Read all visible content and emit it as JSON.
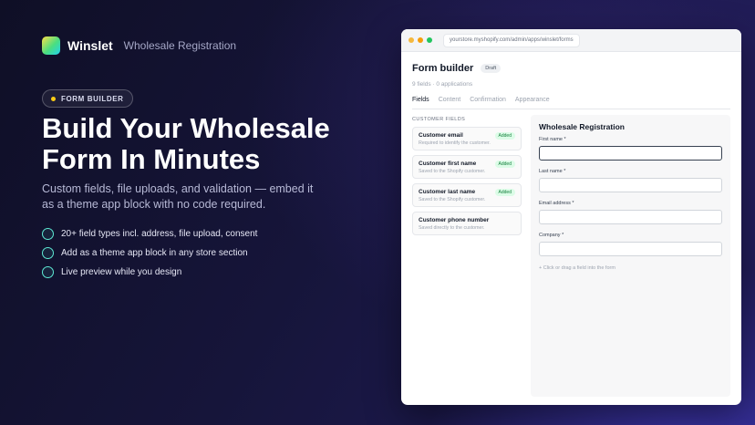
{
  "brand": {
    "name": "Winslet",
    "subtitle": "Wholesale Registration"
  },
  "pill": {
    "label": "FORM BUILDER"
  },
  "hero": {
    "headline": "Build Your Wholesale Form In Minutes",
    "subtext": "Custom fields, file uploads, and validation — embed it as a theme app block with no code required.",
    "features": [
      "20+ field types incl. address, file upload, consent",
      "Add as a theme app block in any store section",
      "Live preview while you design"
    ]
  },
  "browser": {
    "url": "yourstore.myshopify.com/admin/apps/winslet/forms"
  },
  "builder": {
    "title": "Form builder",
    "status": "Draft",
    "meta": "9 fields · 0 applications",
    "tabs": [
      "Fields",
      "Content",
      "Confirmation",
      "Appearance"
    ],
    "active_tab": "Fields",
    "section_label": "CUSTOMER FIELDS",
    "fields": [
      {
        "name": "Customer email",
        "desc": "Required to identify the customer.",
        "badge": "Added"
      },
      {
        "name": "Customer first name",
        "desc": "Saved to the Shopify customer.",
        "badge": "Added"
      },
      {
        "name": "Customer last name",
        "desc": "Saved to the Shopify customer.",
        "badge": "Added"
      },
      {
        "name": "Customer phone number",
        "desc": "Saved directly to the customer.",
        "badge": ""
      }
    ]
  },
  "preview": {
    "title": "Wholesale Registration",
    "inputs": [
      {
        "label": "First name *"
      },
      {
        "label": "Last name *"
      },
      {
        "label": "Email address *"
      },
      {
        "label": "Company *"
      }
    ],
    "hint": "+   Click or drag a field into the form"
  },
  "colors": {
    "accent": "#5eead4",
    "added_badge": "#15803d",
    "background": "#16153a"
  }
}
